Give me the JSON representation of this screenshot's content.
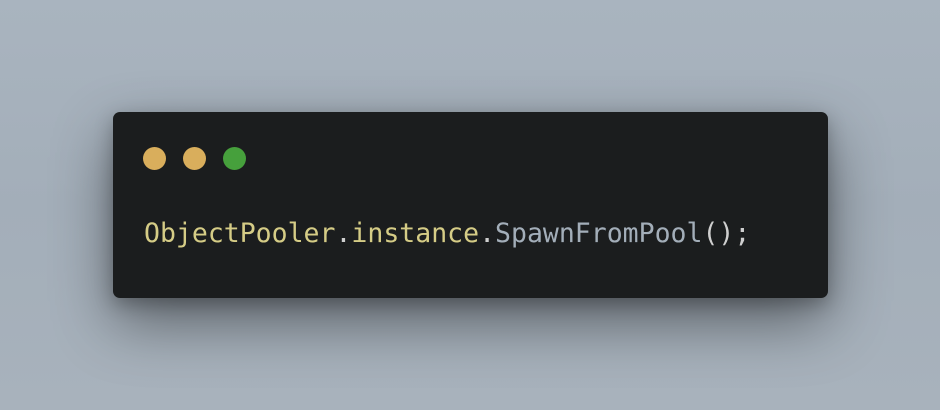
{
  "window": {
    "controls": [
      {
        "name": "close-dot-icon",
        "color": "#d9ae5c"
      },
      {
        "name": "minimize-dot-icon",
        "color": "#d9ae5c"
      },
      {
        "name": "maximize-dot-icon",
        "color": "#46a03c"
      }
    ]
  },
  "code": {
    "tokens": [
      {
        "text": "ObjectPooler",
        "role": "class",
        "color": "#d5cc86"
      },
      {
        "text": ".",
        "role": "punct",
        "color": "#cfcfcf"
      },
      {
        "text": "instance",
        "role": "property",
        "color": "#d5cc86"
      },
      {
        "text": ".",
        "role": "punct",
        "color": "#cfcfcf"
      },
      {
        "text": "SpawnFromPool",
        "role": "method",
        "color": "#a3aeb9"
      },
      {
        "text": "();",
        "role": "punct",
        "color": "#cfcfcf"
      }
    ]
  }
}
